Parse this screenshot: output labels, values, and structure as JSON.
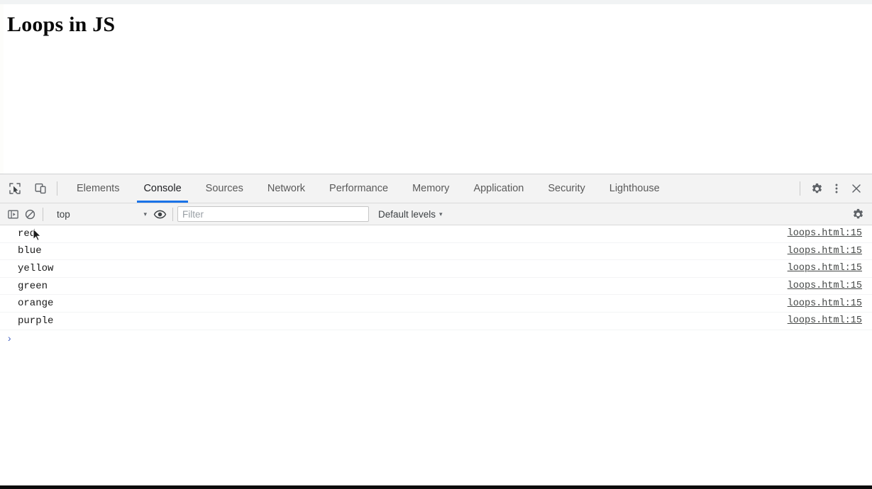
{
  "page": {
    "title": "Loops in JS"
  },
  "devtools": {
    "toolbar_icons": {
      "inspect": "inspect-element-icon",
      "device": "device-toolbar-icon"
    },
    "tabs": [
      {
        "label": "Elements",
        "active": false
      },
      {
        "label": "Console",
        "active": true
      },
      {
        "label": "Sources",
        "active": false
      },
      {
        "label": "Network",
        "active": false
      },
      {
        "label": "Performance",
        "active": false
      },
      {
        "label": "Memory",
        "active": false
      },
      {
        "label": "Application",
        "active": false
      },
      {
        "label": "Security",
        "active": false
      },
      {
        "label": "Lighthouse",
        "active": false
      }
    ],
    "tab_actions": {
      "settings": "settings-gear-icon",
      "more": "more-options-icon",
      "close": "close-icon"
    },
    "console_toolbar": {
      "sidebar_toggle": "console-sidebar-icon",
      "clear": "clear-console-icon",
      "context": "top",
      "context_caret": "▾",
      "live_expression": "eye-icon",
      "filter_placeholder": "Filter",
      "filter_value": "",
      "levels": "Default levels",
      "levels_caret": "▾",
      "settings": "console-settings-gear-icon"
    },
    "console_messages": [
      {
        "text": "red",
        "source": "loops.html:15"
      },
      {
        "text": "blue",
        "source": "loops.html:15"
      },
      {
        "text": "yellow",
        "source": "loops.html:15"
      },
      {
        "text": "green",
        "source": "loops.html:15"
      },
      {
        "text": "orange",
        "source": "loops.html:15"
      },
      {
        "text": "purple",
        "source": "loops.html:15"
      }
    ],
    "prompt": {
      "chevron": "›",
      "value": ""
    }
  },
  "colors": {
    "accent": "#1a73e8",
    "prompt": "#4a66c4",
    "toolbar_bg": "#f3f3f3",
    "text": "#202124"
  }
}
